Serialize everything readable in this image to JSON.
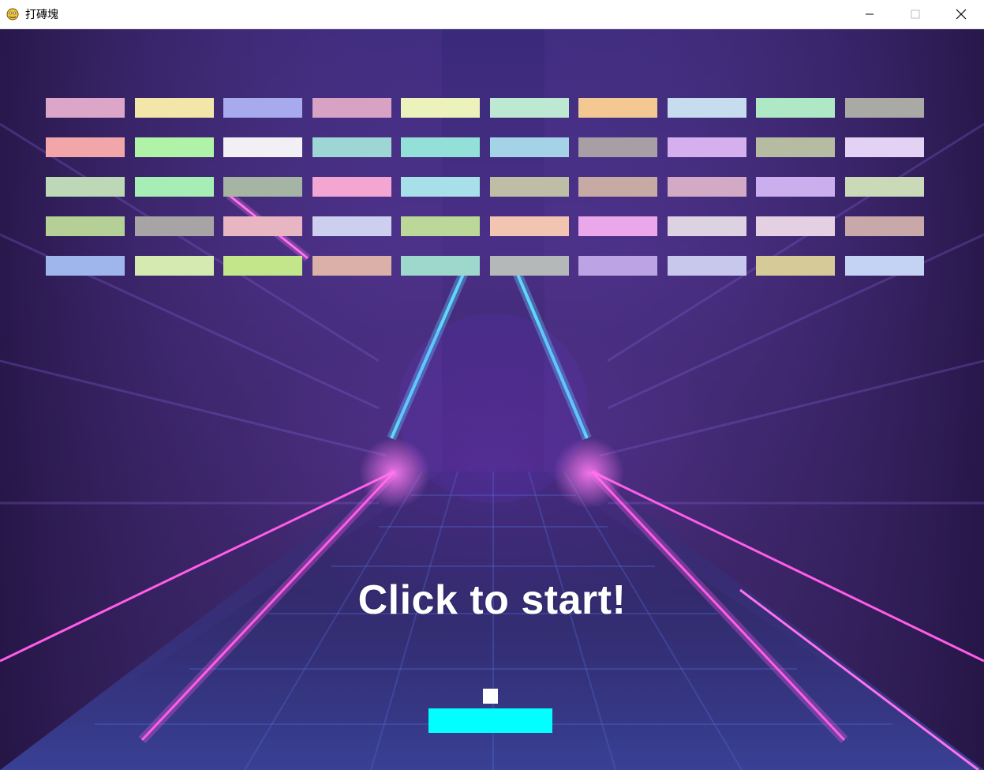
{
  "window": {
    "title": "打磚塊",
    "minimize_icon": "minimize-icon",
    "maximize_icon": "maximize-icon",
    "close_icon": "close-icon"
  },
  "game": {
    "start_text": "Click to start!",
    "paddle_color": "#00ffff",
    "ball_color": "#ffffff",
    "brick_rows": [
      [
        "#dba6c8",
        "#f2e6a8",
        "#a7aaed",
        "#d7a2c4",
        "#ecf2bc",
        "#bde8d2",
        "#f4c892",
        "#c6dcef",
        "#aee8c4",
        "#a9aaa6"
      ],
      [
        "#f2a6aa",
        "#b0f2a8",
        "#f2f0f4",
        "#9ed6d6",
        "#92e0d8",
        "#a4d2e6",
        "#a89ea6",
        "#d6b0ee",
        "#b6bca2",
        "#e4d2f4"
      ],
      [
        "#bcd8b6",
        "#a6eeb6",
        "#a6b4a4",
        "#f4a6d2",
        "#a8e0ea",
        "#bebea6",
        "#c8aaa4",
        "#d2aac6",
        "#caaeee",
        "#cadab8"
      ],
      [
        "#b4d096",
        "#a8a4a6",
        "#e8b6c2",
        "#ccd0ee",
        "#bcd898",
        "#f2c4b2",
        "#eaa8ea",
        "#dcd2e2",
        "#e4d0e2",
        "#c8a8a8"
      ],
      [
        "#9eb6ec",
        "#d4eab0",
        "#c4e68a",
        "#dab0a8",
        "#9ed8cc",
        "#b4b8b8",
        "#bca4e4",
        "#c8c8ec",
        "#d6ca98",
        "#c4d2f4"
      ]
    ]
  }
}
